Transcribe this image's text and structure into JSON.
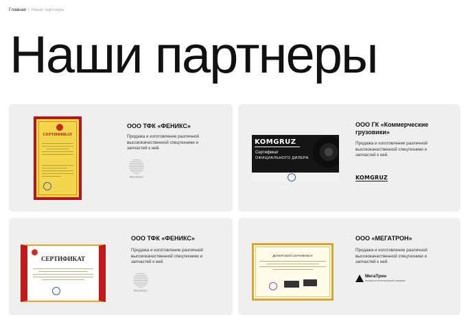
{
  "breadcrumb": {
    "home": "Главная",
    "separator": "/",
    "current": "Наши партнеры"
  },
  "page_title": "Наши партнеры",
  "partners": [
    {
      "name": "ООО ТФК «ФЕНИКС»",
      "description": "Продажа и изготовление различной высококачественной спецтехники и запчастей к ней.",
      "certificate_title": "СЕРТИФИКАТ",
      "logo_label": "ФЕНИКС"
    },
    {
      "name": "ООО ГК «Коммерческие грузовики»",
      "description": "Продажа и изготовление различной высококачественной спецтехники и запчастей к ней.",
      "certificate_brand": "KOMGRUZ",
      "certificate_title": "Сертификат",
      "certificate_subtitle": "ОФИЦИАЛЬНОГО ДИЛЕРА",
      "logo_label": "KOMGRUZ"
    },
    {
      "name": "ООО ТФК «ФЕНИКС»",
      "description": "Продажа и изготовление различной высококачественной спецтехники и запчастей к ней.",
      "certificate_title": "СЕРТИФИКАТ",
      "logo_label": "ФЕНИКС"
    },
    {
      "name": "ООО «МЕГАТРОН»",
      "description": "Продажа и изготовление различной высококачественной спецтехники и запчастей к ней.",
      "certificate_title": "ДИЛЕРСКИЙ СЕРТИФИКАТ",
      "logo_label": "МегаТрон",
      "logo_sublabel": "МАШИНОСТРОИТЕЛЬНЫЙ ХОЛДИНГ"
    }
  ],
  "icons": {
    "fenix": "fenix-logo-icon",
    "komgruz": "komgruz-logo-icon",
    "megatron": "megatron-logo-icon"
  },
  "colors": {
    "card_bg": "#efefef",
    "cert_red": "#b5141a",
    "cert_gold": "#d7a62c"
  }
}
